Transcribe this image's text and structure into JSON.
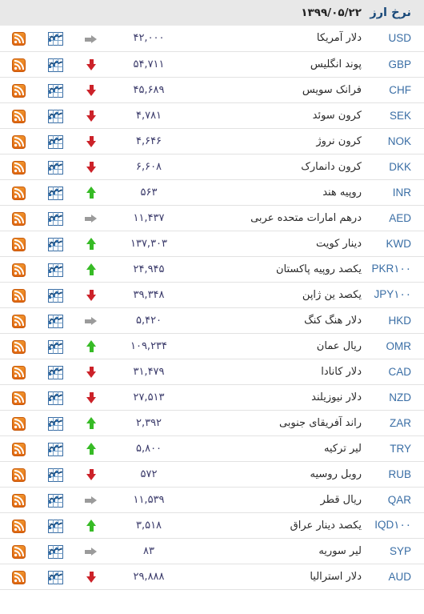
{
  "header": {
    "title": "نرخ ارز",
    "date": "۱۳۹۹/۰۵/۲۲"
  },
  "icons": {
    "rss": "rss-feed-icon",
    "chart": "chart-icon",
    "arrow_up": "arrow-up-icon",
    "arrow_down": "arrow-down-icon",
    "arrow_flat": "arrow-flat-icon"
  },
  "colors": {
    "up": "#37bb26",
    "down": "#cc2229",
    "flat": "#9b9b9b",
    "header_bg": "#e8e8e8",
    "title": "#1a4a7a",
    "code": "#3a6ea5",
    "value": "#3a3a6a",
    "rss_orange": "#e8761a",
    "chart_blue": "#3a6ea5"
  },
  "rows": [
    {
      "code": "USD",
      "code_suffix": "",
      "name": "دلار آمریکا",
      "value": "۴۲,۰۰۰",
      "trend": "flat"
    },
    {
      "code": "GBP",
      "code_suffix": "",
      "name": "پوند انگلیس",
      "value": "۵۴,۷۱۱",
      "trend": "down"
    },
    {
      "code": "CHF",
      "code_suffix": "",
      "name": "فرانک سویس",
      "value": "۴۵,۶۸۹",
      "trend": "down"
    },
    {
      "code": "SEK",
      "code_suffix": "",
      "name": "کرون سوئد",
      "value": "۴,۷۸۱",
      "trend": "down"
    },
    {
      "code": "NOK",
      "code_suffix": "",
      "name": "کرون نروژ",
      "value": "۴,۶۴۶",
      "trend": "down"
    },
    {
      "code": "DKK",
      "code_suffix": "",
      "name": "کرون دانمارک",
      "value": "۶,۶۰۸",
      "trend": "down"
    },
    {
      "code": "INR",
      "code_suffix": "",
      "name": "روپیه هند",
      "value": "۵۶۳",
      "trend": "up"
    },
    {
      "code": "AED",
      "code_suffix": "",
      "name": "درهم امارات متحده عربی",
      "value": "۱۱,۴۳۷",
      "trend": "flat"
    },
    {
      "code": "KWD",
      "code_suffix": "",
      "name": "دینار کویت",
      "value": "۱۳۷,۳۰۳",
      "trend": "up"
    },
    {
      "code": "PKR",
      "code_suffix": "۱۰۰",
      "name": "یکصد روپیه پاکستان",
      "value": "۲۴,۹۴۵",
      "trend": "up"
    },
    {
      "code": "JPY",
      "code_suffix": "۱۰۰",
      "name": "یکصد ین ژاپن",
      "value": "۳۹,۳۴۸",
      "trend": "down"
    },
    {
      "code": "HKD",
      "code_suffix": "",
      "name": "دلار هنگ کنگ",
      "value": "۵,۴۲۰",
      "trend": "flat"
    },
    {
      "code": "OMR",
      "code_suffix": "",
      "name": "ریال عمان",
      "value": "۱۰۹,۲۳۴",
      "trend": "up"
    },
    {
      "code": "CAD",
      "code_suffix": "",
      "name": "دلار کانادا",
      "value": "۳۱,۴۷۹",
      "trend": "down"
    },
    {
      "code": "NZD",
      "code_suffix": "",
      "name": "دلار نیوزیلند",
      "value": "۲۷,۵۱۳",
      "trend": "down"
    },
    {
      "code": "ZAR",
      "code_suffix": "",
      "name": "راند آفریقای جنوبی",
      "value": "۲,۳۹۲",
      "trend": "up"
    },
    {
      "code": "TRY",
      "code_suffix": "",
      "name": "لیر ترکیه",
      "value": "۵,۸۰۰",
      "trend": "up"
    },
    {
      "code": "RUB",
      "code_suffix": "",
      "name": "روبل روسیه",
      "value": "۵۷۲",
      "trend": "down"
    },
    {
      "code": "QAR",
      "code_suffix": "",
      "name": "ریال قطر",
      "value": "۱۱,۵۳۹",
      "trend": "flat"
    },
    {
      "code": "IQD",
      "code_suffix": "۱۰۰",
      "name": "یکصد دینار عراق",
      "value": "۳,۵۱۸",
      "trend": "up"
    },
    {
      "code": "SYP",
      "code_suffix": "",
      "name": "لیر سوریه",
      "value": "۸۳",
      "trend": "flat"
    },
    {
      "code": "AUD",
      "code_suffix": "",
      "name": "دلار استرالیا",
      "value": "۲۹,۸۸۸",
      "trend": "down"
    }
  ]
}
